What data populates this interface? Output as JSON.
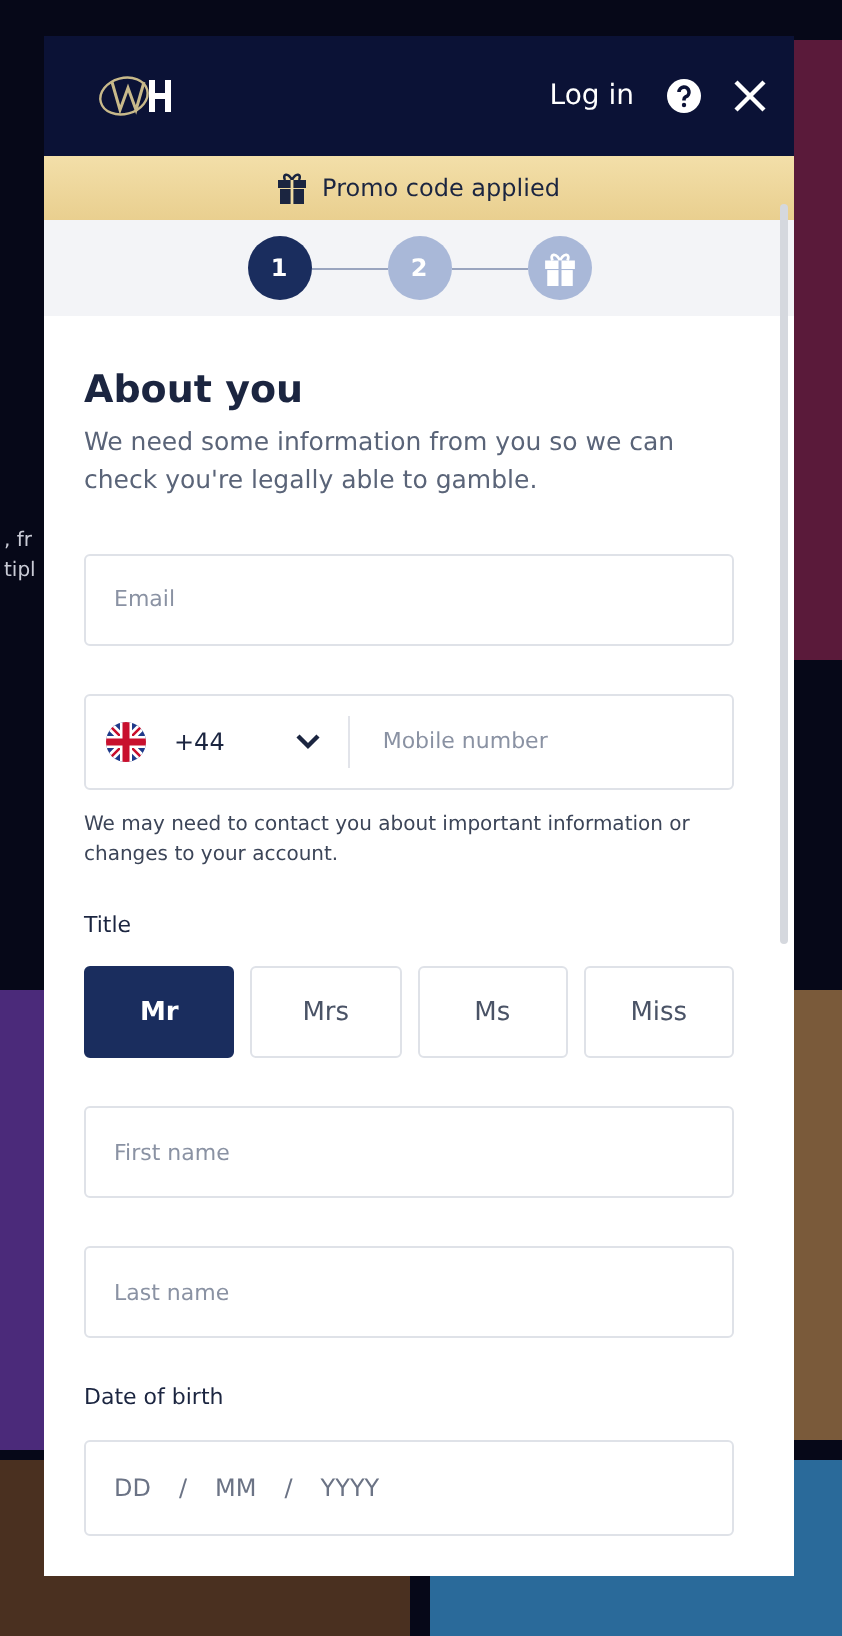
{
  "background": {
    "texts": [
      ", fr",
      "tipl"
    ]
  },
  "header": {
    "login": "Log in"
  },
  "promo": {
    "text": "Promo code applied"
  },
  "steps": [
    {
      "kind": "number",
      "label": "1",
      "selected": true
    },
    {
      "kind": "number",
      "label": "2",
      "selected": false
    },
    {
      "kind": "gift",
      "selected": false
    }
  ],
  "heading": "About you",
  "intro": "We need some information from you so we can check you're legally able to gamble.",
  "email": {
    "placeholder": "Email"
  },
  "phone": {
    "code": "+44",
    "placeholder": "Mobile number"
  },
  "phone_note": "We may need to contact you about important information or changes to your account.",
  "title_label": "Title",
  "titles": [
    {
      "label": "Mr",
      "selected": true
    },
    {
      "label": "Mrs",
      "selected": false
    },
    {
      "label": "Ms",
      "selected": false
    },
    {
      "label": "Miss",
      "selected": false
    }
  ],
  "first_name": {
    "placeholder": "First name"
  },
  "last_name": {
    "placeholder": "Last name"
  },
  "dob_label": "Date of birth",
  "dob": {
    "day": "DD",
    "month": "MM",
    "year": "YYYY",
    "separator": "/"
  }
}
